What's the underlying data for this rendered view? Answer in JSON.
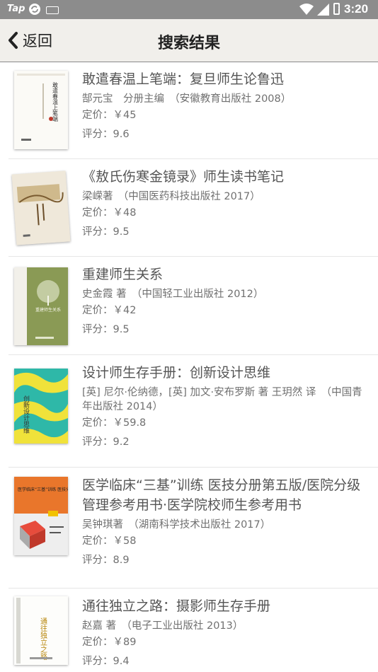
{
  "status_bar": {
    "carrier": "Tap",
    "time": "3:20",
    "battery_glyph": "⚡"
  },
  "header": {
    "back_label": "返回",
    "title": "搜索结果"
  },
  "books": [
    {
      "title": "敢遣春温上笔端：复旦师生论鲁迅",
      "meta": "郜元宝　分册主编　（安徽教育出版社 2008）",
      "price": "定价：￥45",
      "rating": "评分：9.6"
    },
    {
      "title": "《敖氏伤寒金镜录》师生读书笔记",
      "meta": "梁嵘著　（中国医药科技出版社 2017）",
      "price": "定价：￥48",
      "rating": "评分：9.5"
    },
    {
      "title": "重建师生关系",
      "meta": "史金霞 著　（中国轻工业出版社 2012）",
      "price": "定价：￥42",
      "rating": "评分：9.5"
    },
    {
      "title": "设计师生存手册：创新设计思维",
      "meta": "[英] 尼尔·伦纳德，[英] 加文·安布罗斯 著 王玥然 译　（中国青年出版社 2014）",
      "price": "定价：￥59.8",
      "rating": "评分：9.2"
    },
    {
      "title": "医学临床“三基”训练 医技分册第五版/医院分级管理参考用书·医学院校师生参考用书",
      "meta": "吴钟琪著　（湖南科学技术出版社 2017）",
      "price": "定价：￥58",
      "rating": "评分：8.9"
    },
    {
      "title": "通往独立之路：摄影师生存手册",
      "meta": "赵嘉 著　（电子工业出版社 2013）",
      "price": "定价：￥89",
      "rating": "评分：9.4"
    }
  ],
  "covers": {
    "c1_title": "敢遣春温上笔端",
    "c3_title": "重建师生关系",
    "c4_text": "创新设计思维",
    "c5_title": "医学临床“三基”训练 医技分册",
    "c6_title": "通往独立之路"
  },
  "colors": {
    "status_bar": "#8c8c8c",
    "app_bar": "#f1efeb",
    "text": "#555555"
  }
}
